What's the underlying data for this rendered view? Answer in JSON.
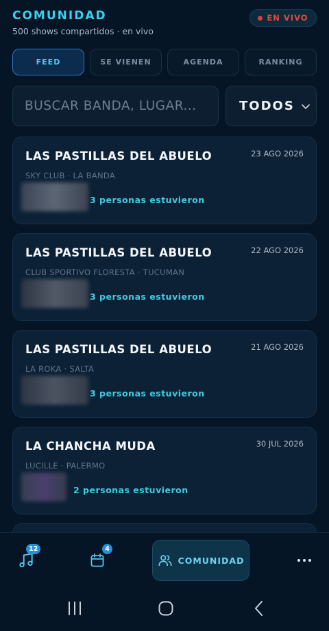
{
  "header": {
    "title": "COMUNIDAD",
    "subtitle": "500 shows compartidos · en vivo",
    "live_label": "EN VIVO"
  },
  "tabs": [
    {
      "label": "FEED",
      "active": true
    },
    {
      "label": "SE VIENEN",
      "active": false
    },
    {
      "label": "AGENDA",
      "active": false
    },
    {
      "label": "RANKING",
      "active": false
    }
  ],
  "search": {
    "placeholder": "BUSCAR BANDA, LUGAR..."
  },
  "filter": {
    "selected": "TODOS"
  },
  "feed": [
    {
      "band": "LAS PASTILLAS DEL ABUELO",
      "date": "23 AGO 2026",
      "venue": "SKY CLUB · LA BANDA",
      "attendance": "3 personas estuvieron"
    },
    {
      "band": "LAS PASTILLAS DEL ABUELO",
      "date": "22 AGO 2026",
      "venue": "CLUB SPORTIVO FLORESTA · TUCUMAN",
      "attendance": "3 personas estuvieron"
    },
    {
      "band": "LAS PASTILLAS DEL ABUELO",
      "date": "21 AGO 2026",
      "venue": "LA ROKA · SALTA",
      "attendance": "3 personas estuvieron"
    },
    {
      "band": "LA CHANCHA MUDA",
      "date": "30 JUL 2026",
      "venue": "LUCILLE · PALERMO",
      "attendance": "2 personas estuvieron"
    }
  ],
  "bottom_nav": {
    "music_badge": "12",
    "calendar_badge": "4",
    "community_label": "COMUNIDAD"
  },
  "icons": [
    "music-note-icon",
    "calendar-icon",
    "users-icon",
    "more-icon",
    "recents-icon",
    "home-icon",
    "back-icon",
    "chevron-down-icon"
  ],
  "colors": {
    "accent": "#35d2f0",
    "live": "#e53b36",
    "background": "#061526",
    "card": "#0c2136"
  }
}
